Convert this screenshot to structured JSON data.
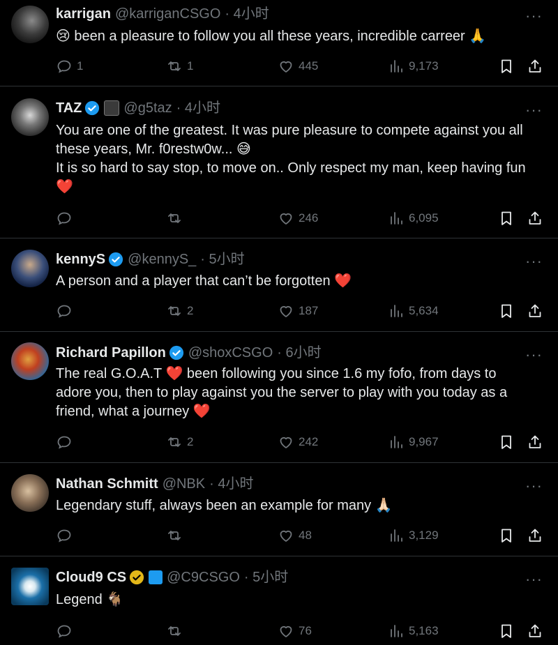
{
  "tweets": [
    {
      "name": "karrigan",
      "handle": "@karriganCSGO",
      "time": "· 4小时",
      "verified": false,
      "lines": [
        "😢 been a pleasure to follow you all these years, incredible carreer 🙏"
      ],
      "replies": "1",
      "retweets": "1",
      "likes": "445",
      "views": "9,173"
    },
    {
      "name": "TAZ",
      "handle": "@g5taz",
      "time": "· 4小时",
      "verified": true,
      "lines": [
        "You are one of the greatest. It was pure pleasure to compete against you all",
        "these years, Mr. f0restw0w... 😅",
        "It is so hard to say stop, to move on.. Only respect my man, keep having fun",
        "❤️"
      ],
      "replies": "",
      "retweets": "",
      "likes": "246",
      "views": "6,095"
    },
    {
      "name": "kennyS",
      "handle": "@kennyS_",
      "time": "· 5小时",
      "verified": true,
      "lines": [
        "A person and a player that can’t be forgotten ❤️"
      ],
      "replies": "",
      "retweets": "2",
      "likes": "187",
      "views": "5,634"
    },
    {
      "name": "Richard Papillon",
      "handle": "@shoxCSGO",
      "time": "· 6小时",
      "verified": true,
      "lines": [
        "The real G.O.A.T ❤️ been following you since 1.6 my fofo, from days to",
        "adore you, then to play against you the server to play with you today as a",
        "friend, what a journey ❤️"
      ],
      "replies": "",
      "retweets": "2",
      "likes": "242",
      "views": "9,967"
    },
    {
      "name": "Nathan Schmitt",
      "handle": "@NBK",
      "time": "· 4小时",
      "verified": false,
      "lines": [
        "Legendary stuff, always been an example for many 🙏🏻"
      ],
      "replies": "",
      "retweets": "",
      "likes": "48",
      "views": "3,129"
    },
    {
      "name": "Cloud9 CS",
      "handle": "@C9CSGO",
      "time": "· 5小时",
      "verified": true,
      "lines": [
        "Legend 🐐"
      ],
      "replies": "",
      "retweets": "",
      "likes": "76",
      "views": "5,163"
    }
  ],
  "icons": {
    "more": "more-icon",
    "reply": "reply-icon",
    "retweet": "retweet-icon",
    "like": "heart-icon",
    "views": "views-icon",
    "bookmark": "bookmark-icon",
    "share": "share-icon"
  },
  "colors": {
    "background": "#000000",
    "text": "#e7e9ea",
    "muted": "#71767b",
    "divider": "#2f3336",
    "verified_blue": "#1d9bf0",
    "verified_gold": "#e2b719"
  }
}
